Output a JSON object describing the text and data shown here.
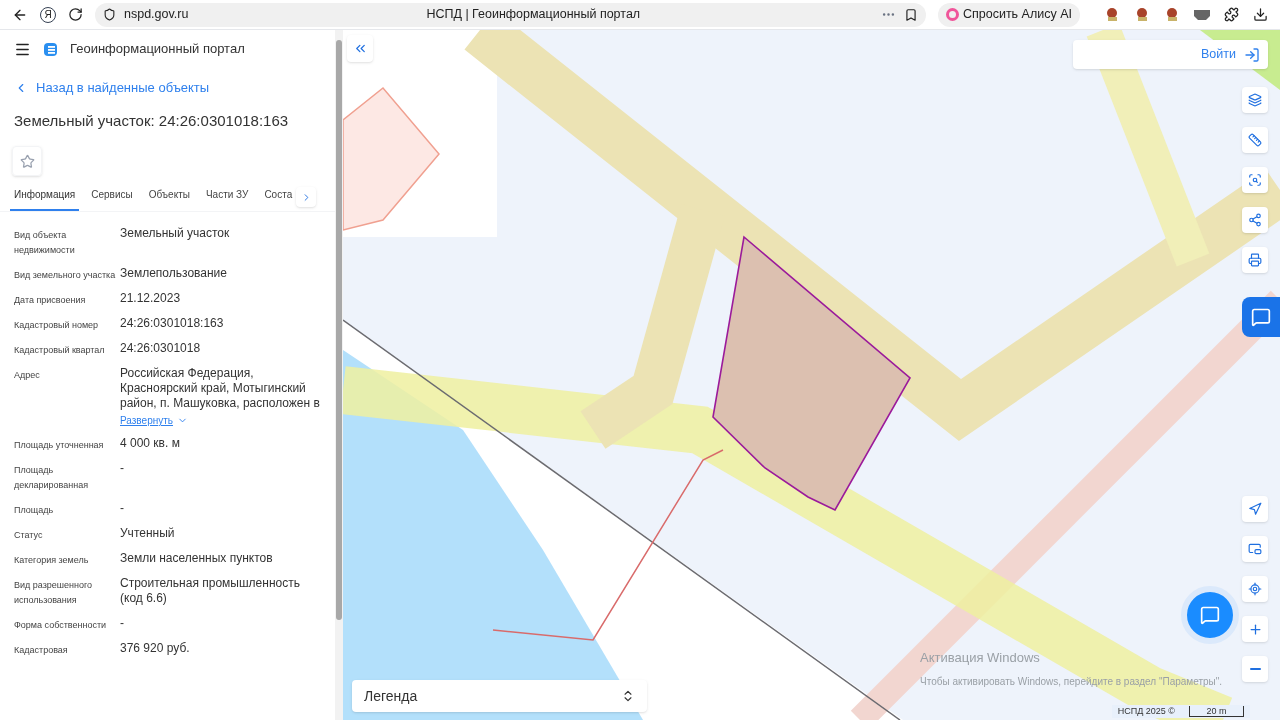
{
  "browser": {
    "yandex": "Я",
    "url": "nspd.gov.ru",
    "title": "НСПД | Геоинформационный портал",
    "alice": "Спросить Алису AI"
  },
  "sidebar": {
    "portal_title": "Геоинформационный портал",
    "back_link": "Назад в найденные объекты",
    "heading": "Земельный участок: 24:26:0301018:163",
    "tabs": [
      {
        "label": "Информация",
        "selected": true
      },
      {
        "label": "Сервисы",
        "selected": false
      },
      {
        "label": "Объекты",
        "selected": false
      },
      {
        "label": "Части ЗУ",
        "selected": false
      },
      {
        "label": "Соста",
        "selected": false
      }
    ],
    "fields": [
      {
        "label": "Вид объекта недвижимости",
        "value": "Земельный участок"
      },
      {
        "label": "Вид земельного участка",
        "value": "Землепользование"
      },
      {
        "label": "Дата присвоения",
        "value": "21.12.2023"
      },
      {
        "label": "Кадастровый номер",
        "value": "24:26:0301018:163"
      },
      {
        "label": "Кадастровый квартал",
        "value": "24:26:0301018"
      },
      {
        "label": "Адрес",
        "value": "Российская Федерация, Красноярский край, Мотыгинский район, п. Машуковка, расположен в",
        "expand_link": "Развернуть"
      },
      {
        "label": "Площадь уточненная",
        "value": "4 000 кв. м"
      },
      {
        "label": "Площадь декларированная",
        "value": "-"
      },
      {
        "label": "Площадь",
        "value": "-"
      },
      {
        "label": "Статус",
        "value": "Учтенный"
      },
      {
        "label": "Категория земель",
        "value": "Земли населенных пунктов"
      },
      {
        "label": "Вид разрешенного использования",
        "value": "Строительная промышленность (код 6.6)"
      },
      {
        "label": "Форма собственности",
        "value": "-"
      },
      {
        "label": "Кадастровая",
        "value": "376 920 руб."
      }
    ]
  },
  "map": {
    "login": "Войти",
    "legend": "Легенда",
    "attribution": "НСПД 2025 ©",
    "scale": "20 m"
  },
  "os_notice": {
    "title": "Активация Windows",
    "text": "Чтобы активировать Windows, перейдите в раздел \"Параметры\"."
  }
}
